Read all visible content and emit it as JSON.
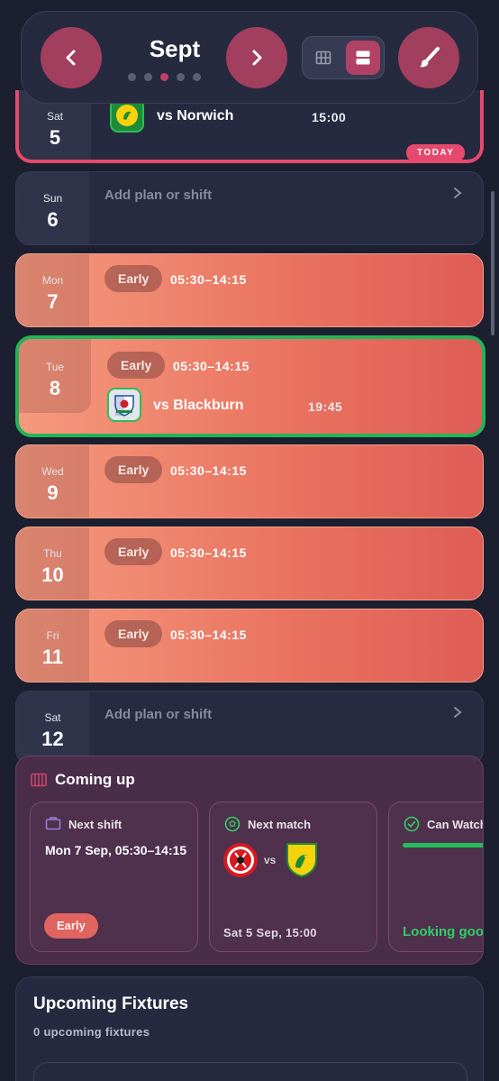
{
  "header": {
    "month": "Sept",
    "prev_icon": "chevron-left-icon",
    "next_icon": "chevron-right-icon",
    "grid_view_icon": "grid-icon",
    "list_view_icon": "list-icon",
    "theme_icon": "paintbrush-icon",
    "page_dots": 5,
    "active_dot": 3
  },
  "days": {
    "sat5": {
      "name": "Sat",
      "num": "5",
      "opponent": "vs Norwich",
      "kickoff": "15:00",
      "badge": "TODAY"
    },
    "sun6": {
      "name": "Sun",
      "num": "6",
      "placeholder": "Add plan or shift"
    },
    "mon7": {
      "name": "Mon",
      "num": "7",
      "shift": "Early",
      "time": "05:30–14:15"
    },
    "tue8": {
      "name": "Tue",
      "num": "8",
      "shift": "Early",
      "time": "05:30–14:15",
      "opponent": "vs Blackburn",
      "kickoff": "19:45"
    },
    "wed9": {
      "name": "Wed",
      "num": "9",
      "shift": "Early",
      "time": "05:30–14:15"
    },
    "thu10": {
      "name": "Thu",
      "num": "10",
      "shift": "Early",
      "time": "05:30–14:15"
    },
    "fri11": {
      "name": "Fri",
      "num": "11",
      "shift": "Early",
      "time": "05:30–14:15"
    },
    "sat12": {
      "name": "Sat",
      "num": "12",
      "placeholder": "Add plan or shift"
    }
  },
  "coming_up": {
    "title": "Coming up",
    "next_shift": {
      "title": "Next shift",
      "body": "Mon 7 Sep, 05:30–14:15",
      "pill": "Early"
    },
    "next_match": {
      "title": "Next match",
      "vs": "vs",
      "footer": "Sat 5 Sep, 15:00"
    },
    "can_watch": {
      "title": "Can Watch",
      "footer": "Looking good"
    }
  },
  "fixtures": {
    "title": "Upcoming Fixtures",
    "subtitle": "0 upcoming fixtures"
  },
  "colors": {
    "accent": "#a23e5e",
    "today_border": "#e5496d",
    "highlight_border": "#21b556",
    "shift_gradient_start": "#f59a7e",
    "shift_gradient_end": "#de5d56"
  }
}
